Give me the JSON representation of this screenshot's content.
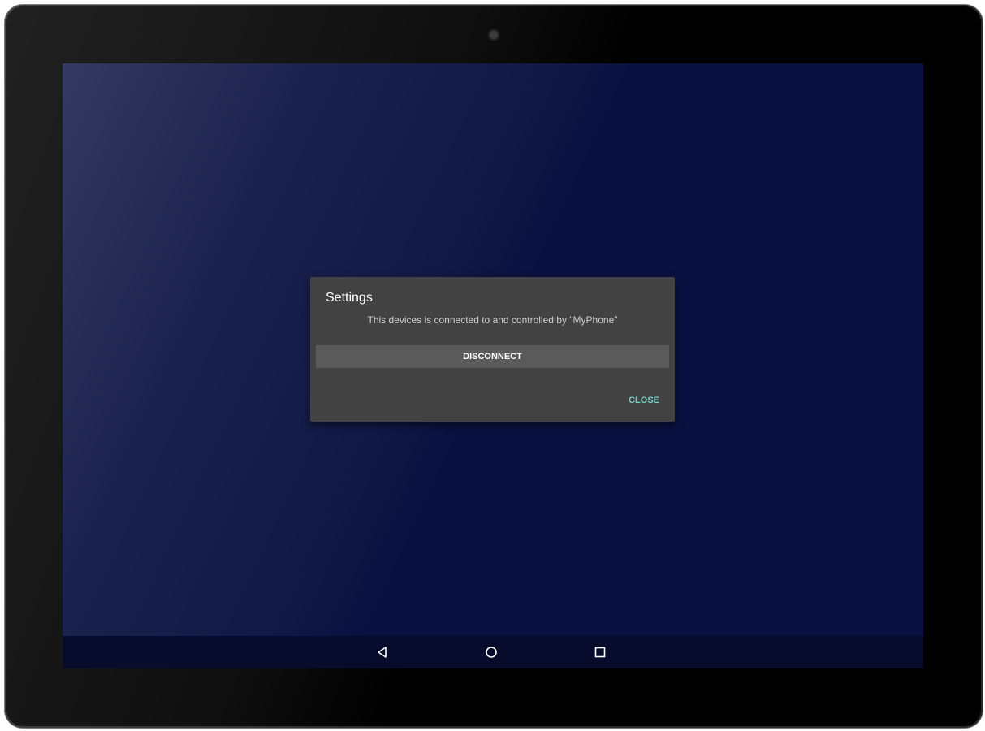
{
  "dialog": {
    "title": "Settings",
    "message": "This devices is connected to and controlled by \"MyPhone\"",
    "disconnect_label": "DISCONNECT",
    "close_label": "CLOSE"
  },
  "navbar": {
    "back_icon": "back-icon",
    "home_icon": "home-icon",
    "recents_icon": "recents-icon"
  },
  "colors": {
    "screen_background": "#0a1140",
    "dialog_background": "#424242",
    "close_accent": "#80cbc4"
  }
}
